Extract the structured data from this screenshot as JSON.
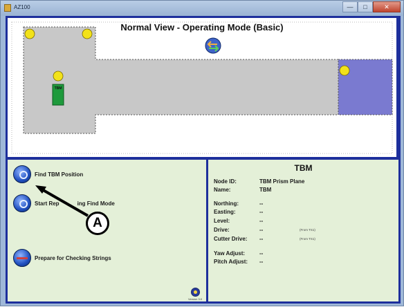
{
  "window": {
    "title": "AZ100"
  },
  "view": {
    "title": "Normal View - Operating Mode (Basic)",
    "tbm_marker_label": "TBM"
  },
  "actions": {
    "find_tbm": "Find TBM Position",
    "start_mode": "Start Rep",
    "start_mode_tail": "ing Find Mode",
    "prepare_strings": "Prepare for Checking Strings"
  },
  "version_label": "Version 3.0",
  "callout": {
    "letter": "A"
  },
  "tbm_panel": {
    "title": "TBM",
    "rows": [
      {
        "label": "Node ID:",
        "value": "TBM Prism Plane",
        "note": ""
      },
      {
        "label": "Name:",
        "value": "TBM",
        "note": ""
      },
      {
        "label": "Northing:",
        "value": "--",
        "note": ""
      },
      {
        "label": "Easting:",
        "value": "--",
        "note": ""
      },
      {
        "label": "Level:",
        "value": "--",
        "note": ""
      },
      {
        "label": "Drive:",
        "value": "--",
        "note": "(From TS1)"
      },
      {
        "label": "Cutter Drive:",
        "value": "--",
        "note": "(From TS1)"
      },
      {
        "label": "Yaw Adjust:",
        "value": "--",
        "note": ""
      },
      {
        "label": "Pitch Adjust:",
        "value": "--",
        "note": ""
      }
    ]
  },
  "colors": {
    "panel_border": "#1d2f9c",
    "panel_bg": "#e4f0d8",
    "map_shape": "#c8c8c8",
    "tbm_block": "#1e9a3c",
    "marker": "#f2e21a",
    "end_zone": "#7a7ad0"
  }
}
